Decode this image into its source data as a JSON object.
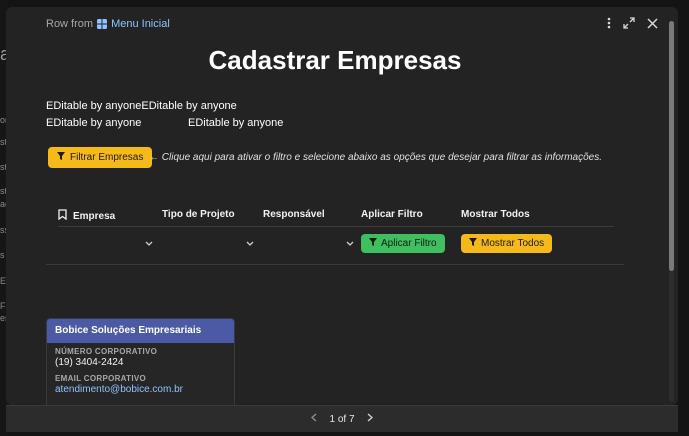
{
  "background_app": {
    "fragments": [
      "a",
      "or",
      "sti",
      "stu",
      "sti",
      "ac",
      "ss",
      "s",
      "E",
      "F",
      "es"
    ]
  },
  "modal": {
    "breadcrumb_prefix": "Row from",
    "breadcrumb_link": "Menu Inicial",
    "title": "Cadastrar Empresas",
    "edit_line_1": "EDitable by anyoneEDitable by anyone",
    "edit_line_2a": "EDitable by anyone",
    "edit_line_2b": "EDitable by anyone",
    "filter_button_label": "Filtrar Empresas",
    "hint_text": "← Clique aqui para ativar o filtro e selecione abaixo as opções que desejar para filtrar as informações.",
    "columns": {
      "empresa": "Empresa",
      "tipo": "Tipo de Projeto",
      "responsavel": "Responsável",
      "aplicar": "Aplicar Filtro",
      "mostrar": "Mostrar Todos"
    },
    "apply_button_label": "Aplicar Filtro",
    "show_button_label": "Mostrar Todos",
    "card": {
      "company_name": "Bobice Soluções Empresariais",
      "phone_label": "NÚMERO CORPORATIVO",
      "phone_value": "(19) 3404-2424",
      "email_label": "EMAIL CORPORATIVO",
      "email_value": "atendimento@bobice.com.br"
    },
    "pagination": "1 of 7"
  },
  "colors": {
    "accent_yellow": "#f5b91a",
    "accent_green": "#3fbf5f",
    "card_header": "#4a5aa5",
    "link": "#8fc3ff"
  },
  "icons": [
    "grid-icon",
    "more-icon",
    "expand-icon",
    "close-icon",
    "filter-icon",
    "bookmark-icon",
    "chevron-down-icon",
    "chevron-left-icon",
    "chevron-right-icon"
  ]
}
